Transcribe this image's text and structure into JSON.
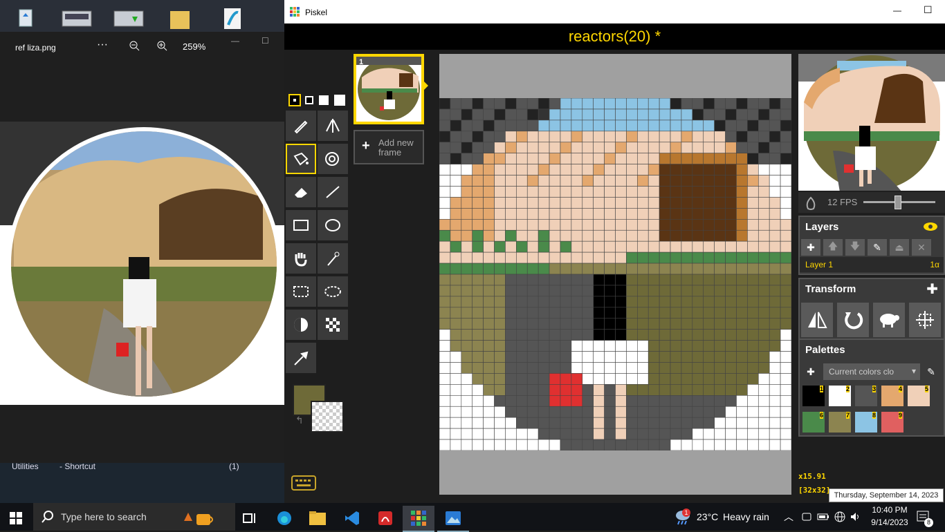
{
  "photos": {
    "filename": "ref liza.png",
    "more_icon": "more-icon",
    "zoom_level": "259%"
  },
  "desktop": {
    "utilities_label": "Utilities",
    "shortcut_label": "- Shortcut",
    "count_label": "(1)"
  },
  "piskel": {
    "window_title": "Piskel",
    "doc_title": "reactors(20) *",
    "frame_number": "1",
    "add_frame_label": "Add new frame",
    "fps_label": "12 FPS",
    "fps_value": 12,
    "layers": {
      "title": "Layers",
      "layer_name": "Layer 1",
      "layer_opacity": "1α"
    },
    "transform": {
      "title": "Transform"
    },
    "palettes": {
      "title": "Palettes",
      "selected": "Current colors clo",
      "colors": [
        {
          "n": "1",
          "hex": "#000000"
        },
        {
          "n": "2",
          "hex": "#ffffff"
        },
        {
          "n": "3",
          "hex": "#555555"
        },
        {
          "n": "4",
          "hex": "#e4a86e"
        },
        {
          "n": "5",
          "hex": "#f0d0b8"
        },
        {
          "n": "6",
          "hex": "#4a8a4a"
        },
        {
          "n": "7",
          "hex": "#8c8450"
        },
        {
          "n": "8",
          "hex": "#8cc4e4"
        },
        {
          "n": "9",
          "hex": "#e06060"
        }
      ]
    },
    "cursor_coords": "x15.91",
    "canvas_size": "[32x32]",
    "primary_color": "#6e6a38",
    "accent": "#ffd700"
  },
  "taskbar": {
    "search_placeholder": "Type here to search",
    "weather_temp": "23°C",
    "weather_desc": "Heavy rain",
    "weather_badge": "1",
    "time": "10:40 PM",
    "date": "9/14/2023",
    "notification_count": "8",
    "tooltip": "Thursday, September 14, 2023"
  }
}
